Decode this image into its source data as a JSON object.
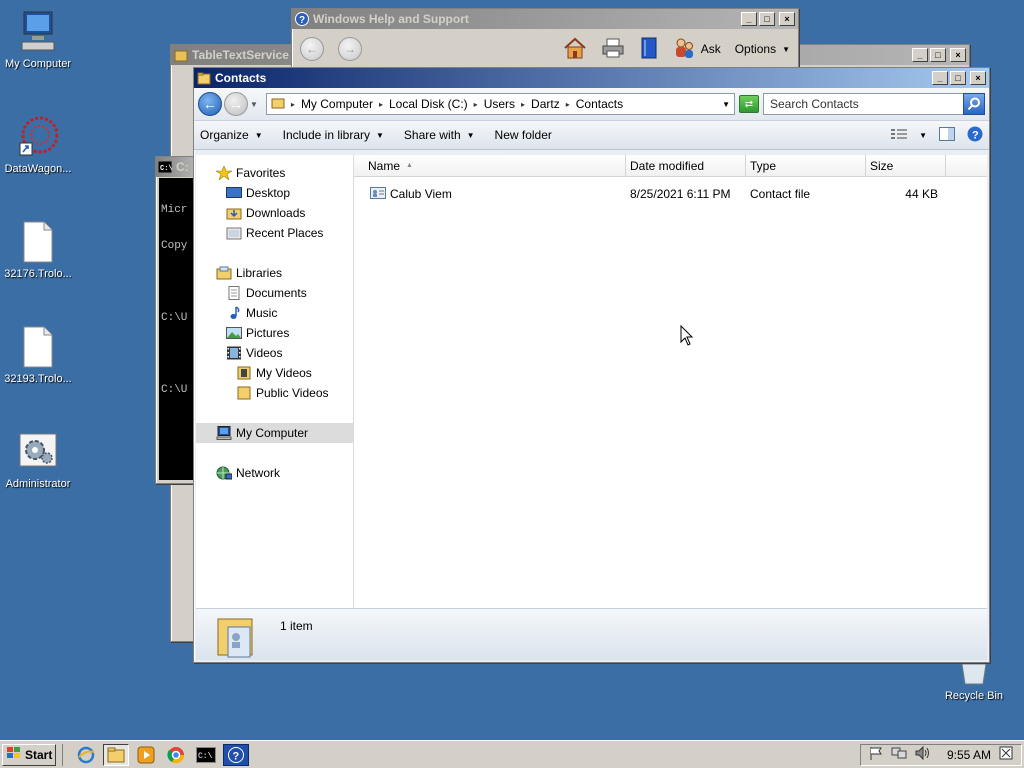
{
  "desktop": {
    "icons": [
      {
        "label": "My Computer"
      },
      {
        "label": "DataWagon..."
      },
      {
        "label": "32176.Trolo..."
      },
      {
        "label": "32193.Trolo..."
      },
      {
        "label": "Administrator"
      },
      {
        "label": "Recycle Bin"
      }
    ]
  },
  "help_window": {
    "title": "Windows Help and Support",
    "ask_label": "Ask",
    "options_label": "Options"
  },
  "back_window": {
    "title": "TableTextService"
  },
  "cmd_window": {
    "title": "C:",
    "lines": [
      "Micr",
      "Copy",
      "C:\\U",
      "C:\\U"
    ]
  },
  "explorer": {
    "title": "Contacts",
    "breadcrumbs": [
      "My Computer",
      "Local Disk (C:)",
      "Users",
      "Dartz",
      "Contacts"
    ],
    "search_placeholder": "Search Contacts",
    "commands": [
      "Organize",
      "Include in library",
      "Share with",
      "New folder"
    ],
    "nav": {
      "favorites": "Favorites",
      "desktop": "Desktop",
      "downloads": "Downloads",
      "recent": "Recent Places",
      "libraries": "Libraries",
      "documents": "Documents",
      "music": "Music",
      "pictures": "Pictures",
      "videos": "Videos",
      "my_videos": "My Videos",
      "public_videos": "Public Videos",
      "my_computer": "My Computer",
      "network": "Network"
    },
    "columns": {
      "name": "Name",
      "date": "Date modified",
      "type": "Type",
      "size": "Size"
    },
    "files": [
      {
        "name": "Calub Viem",
        "date": "8/25/2021 6:11 PM",
        "type": "Contact file",
        "size": "44 KB"
      }
    ],
    "status": "1 item"
  },
  "taskbar": {
    "start_label": "Start",
    "clock": "9:55 AM"
  },
  "colors": {
    "desktop": "#3a6ea5",
    "title_active": "#0a246a",
    "title_inactive": "#808080"
  }
}
